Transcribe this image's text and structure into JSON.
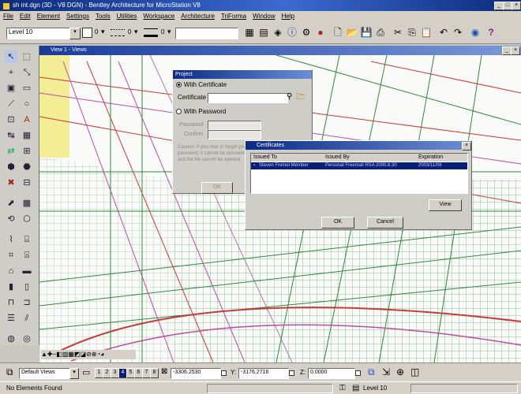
{
  "app": {
    "title": "sh int.dgn (3D - V8 DGN) - Bentley Architecture for MicroStation V8"
  },
  "menu": [
    "File",
    "Edit",
    "Element",
    "Settings",
    "Tools",
    "Utilities",
    "Workspace",
    "Architecture",
    "TriForma",
    "Window",
    "Help"
  ],
  "toolbar": {
    "level_value": "Level 10",
    "color_value": "0",
    "style_value": "0",
    "weight_value": "0"
  },
  "view": {
    "title": "View 1 - Views"
  },
  "project_dialog": {
    "title": "Project",
    "option_certificate": "With Certificate",
    "certificate_label": "Certificate",
    "option_password": "With Password",
    "password_label": "Password",
    "confirm_label": "Confirm",
    "help_text": "Caution: If you lose or forget your password, it cannot be recovered and the file cannot be opened",
    "ok_label": "OK"
  },
  "cert_dialog": {
    "title": "Certificates",
    "columns": [
      "Issued To",
      "Issued By",
      "Expiration"
    ],
    "rows": [
      {
        "issued_to": "Steven Fremel Member",
        "issued_by": "Personal Freemail RSA 2000.8.30",
        "expiration": "2003/11/06"
      }
    ],
    "view_label": "View",
    "ok_label": "OK",
    "cancel_label": "Cancel"
  },
  "viewbar": {
    "saved_views": "Default Views",
    "view_numbers": [
      "1",
      "2",
      "3",
      "4",
      "5",
      "6",
      "7",
      "8"
    ],
    "active_view": "4",
    "x_label": "X:",
    "x_value": "-3306.2530",
    "y_label": "Y:",
    "y_value": "-3176.2716",
    "z_label": "Z:",
    "z_value": "0.0000"
  },
  "status": {
    "message": "No Elements Found",
    "level": "Level 10"
  },
  "colors": {
    "accent": "#0c2a86",
    "wire_green": "#2e8b3e",
    "wire_red": "#c83a3a",
    "wire_magenta": "#c04aa8",
    "selection": "#0a1f78"
  }
}
